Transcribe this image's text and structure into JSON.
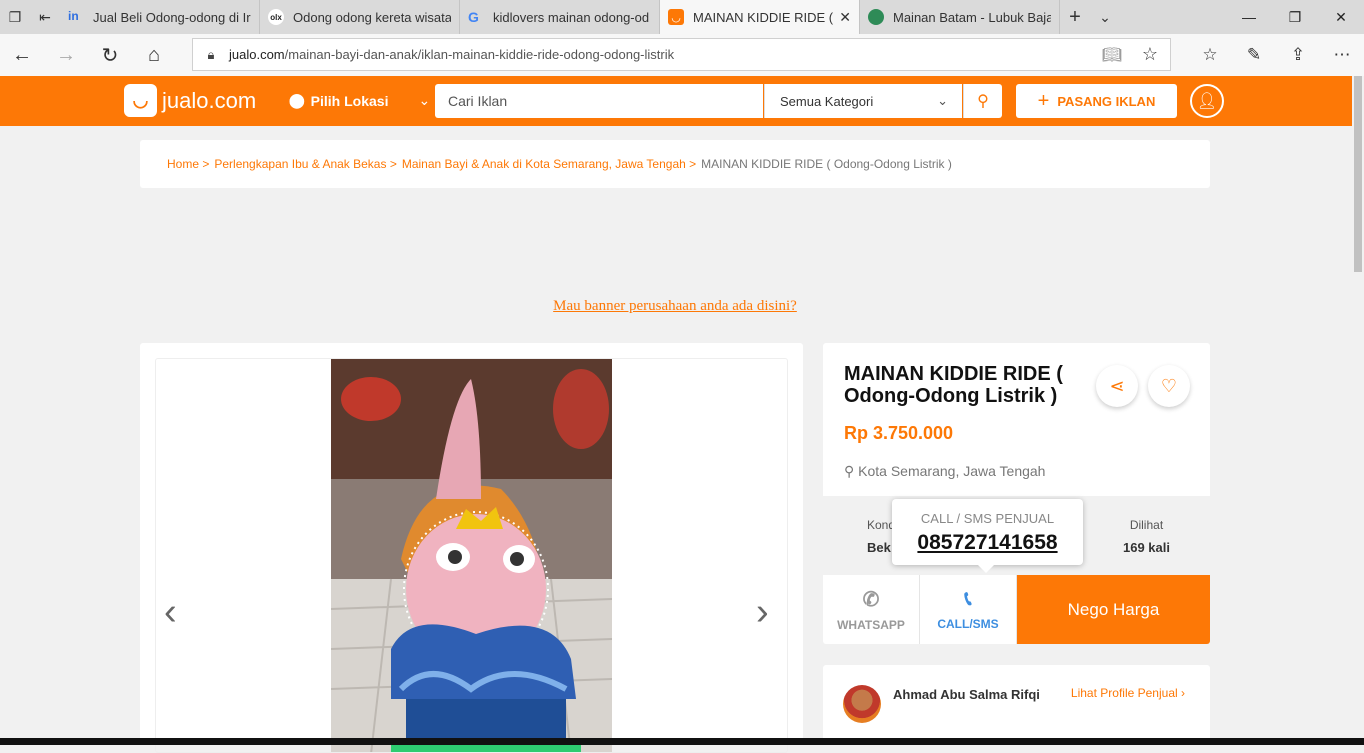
{
  "browser": {
    "tabs": [
      {
        "title": "Jual Beli Odong-odong di Ir",
        "fav_color": "#2f6ee0",
        "fav_text": "in"
      },
      {
        "title": "Odong odong kereta wisata",
        "fav_color": "#ffffff",
        "fav_text": "olx"
      },
      {
        "title": "kidlovers mainan odong-od",
        "fav_color": "#ffffff",
        "fav_text": "G"
      },
      {
        "title": "MAINAN KIDDIE RIDE (",
        "fav_color": "#fd7806",
        "fav_text": "◡"
      },
      {
        "title": "Mainan Batam - Lubuk Baja",
        "fav_color": "#2e8b57",
        "fav_text": "◉"
      }
    ],
    "url_domain": "jualo.com",
    "url_path": "/mainan-bayi-dan-anak/iklan-mainan-kiddie-ride-odong-odong-listrik"
  },
  "header": {
    "logo_text": "jualo.com",
    "location_label": "Pilih Lokasi",
    "search_placeholder": "Cari Iklan",
    "category_label": "Semua Kategori",
    "post_ad_label": "PASANG IKLAN",
    "brand_color": "#fd7806"
  },
  "breadcrumb": {
    "items": [
      "Home >",
      "Perlengkapan Ibu & Anak Bekas >",
      "Mainan Bayi & Anak di Kota Semarang, Jawa Tengah >"
    ],
    "current": "MAINAN KIDDIE RIDE ( Odong-Odong Listrik )"
  },
  "banner_link": "Mau banner perusahaan anda ada disini?",
  "listing": {
    "title": "MAINAN KIDDIE RIDE ( Odong-Odong Listrik )",
    "price": "Rp 3.750.000",
    "location": "Kota Semarang, Jawa Tengah",
    "condition_label": "Kond",
    "condition_value": "Bek",
    "views_label": "Dilihat",
    "views_value": "169 kali"
  },
  "contact_popup": {
    "label": "CALL / SMS PENJUAL",
    "phone": "085727141658"
  },
  "actions": {
    "whatsapp": "WHATSAPP",
    "call": "CALL/SMS",
    "nego": "Nego Harga"
  },
  "seller": {
    "name": "Ahmad Abu Salma Rifqi",
    "profile_link": "Lihat Profile Penjual ›"
  }
}
